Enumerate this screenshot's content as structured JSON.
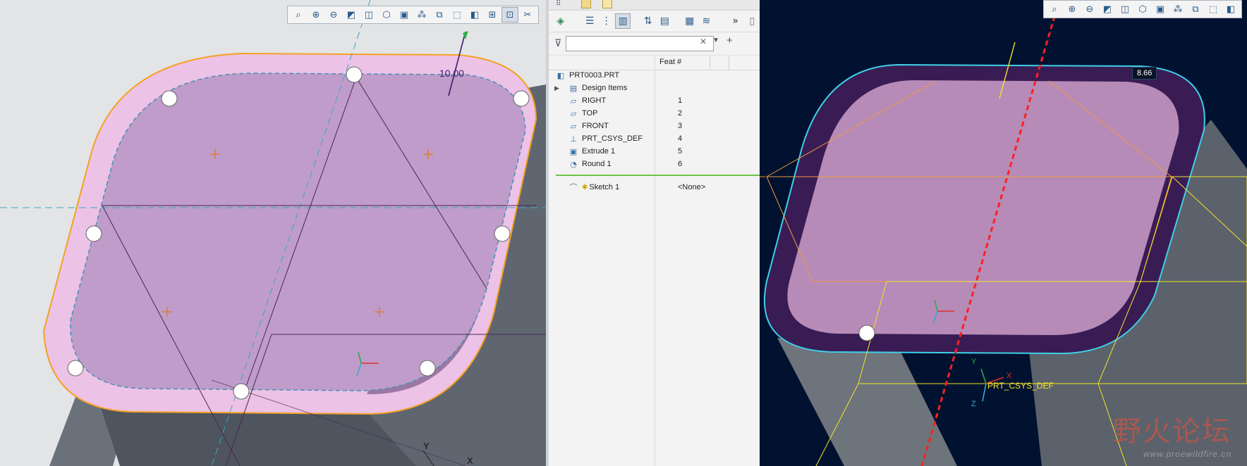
{
  "left_viewport": {
    "dimension_value": "10.00",
    "axis_labels": {
      "y": "Y",
      "x": "X"
    },
    "toolbar": [
      {
        "icon": "refit-icon",
        "glyph": "⌕"
      },
      {
        "icon": "zoom-in-icon",
        "glyph": "⊕"
      },
      {
        "icon": "zoom-out-icon",
        "glyph": "⊖"
      },
      {
        "icon": "repaint-icon",
        "glyph": "◩"
      },
      {
        "icon": "display-style-icon",
        "glyph": "◫"
      },
      {
        "icon": "saved-orientations-icon",
        "glyph": "⬡"
      },
      {
        "icon": "view-manager-icon",
        "glyph": "▣"
      },
      {
        "icon": "datum-display-icon",
        "glyph": "⁂"
      },
      {
        "icon": "annotation-display-icon",
        "glyph": "⧉"
      },
      {
        "icon": "perspective-icon",
        "glyph": "⬚"
      },
      {
        "icon": "section-icon",
        "glyph": "◧"
      },
      {
        "icon": "spin-center-icon",
        "glyph": "⊞"
      },
      {
        "icon": "sketch-view-icon",
        "glyph": "⊡"
      },
      {
        "icon": "sketch-display-icon",
        "glyph": "✂"
      }
    ]
  },
  "right_viewport": {
    "dimension_value": "8.66",
    "csys_label": "PRT_CSYS_DEF",
    "axis_labels": {
      "y": "Y",
      "x": "X",
      "z": "Z"
    },
    "toolbar": [
      {
        "icon": "refit-icon",
        "glyph": "⌕"
      },
      {
        "icon": "zoom-in-icon",
        "glyph": "⊕"
      },
      {
        "icon": "zoom-out-icon",
        "glyph": "⊖"
      },
      {
        "icon": "repaint-icon",
        "glyph": "◩"
      },
      {
        "icon": "display-style-icon",
        "glyph": "◫"
      },
      {
        "icon": "saved-orientations-icon",
        "glyph": "⬡"
      },
      {
        "icon": "view-manager-icon",
        "glyph": "▣"
      },
      {
        "icon": "datum-display-icon",
        "glyph": "⁂"
      },
      {
        "icon": "annotation-display-icon",
        "glyph": "⧉"
      },
      {
        "icon": "perspective-icon",
        "glyph": "⬚"
      },
      {
        "icon": "section-icon",
        "glyph": "◧"
      }
    ],
    "watermark": {
      "text": "野火论坛",
      "url": "www.proewildfire.cn"
    }
  },
  "model_tree": {
    "column_header": "Feat #",
    "filter_placeholder": "",
    "root": "PRT0003.PRT",
    "items": [
      {
        "label": "Design Items",
        "feat": "",
        "icon": "design-items-icon",
        "glyph": "▤"
      },
      {
        "label": "RIGHT",
        "feat": "1",
        "icon": "datum-plane-icon",
        "glyph": "▱"
      },
      {
        "label": "TOP",
        "feat": "2",
        "icon": "datum-plane-icon",
        "glyph": "▱"
      },
      {
        "label": "FRONT",
        "feat": "3",
        "icon": "datum-plane-icon",
        "glyph": "▱"
      },
      {
        "label": "PRT_CSYS_DEF",
        "feat": "4",
        "icon": "csys-icon",
        "glyph": "⊥"
      },
      {
        "label": "Extrude 1",
        "feat": "5",
        "icon": "extrude-icon",
        "glyph": "▣"
      },
      {
        "label": "Round 1",
        "feat": "6",
        "icon": "round-icon",
        "glyph": "◔"
      }
    ],
    "insert_item": {
      "label": "Sketch 1",
      "feat": "<None>",
      "icon": "sketch-icon",
      "glyph": "⌒"
    }
  }
}
